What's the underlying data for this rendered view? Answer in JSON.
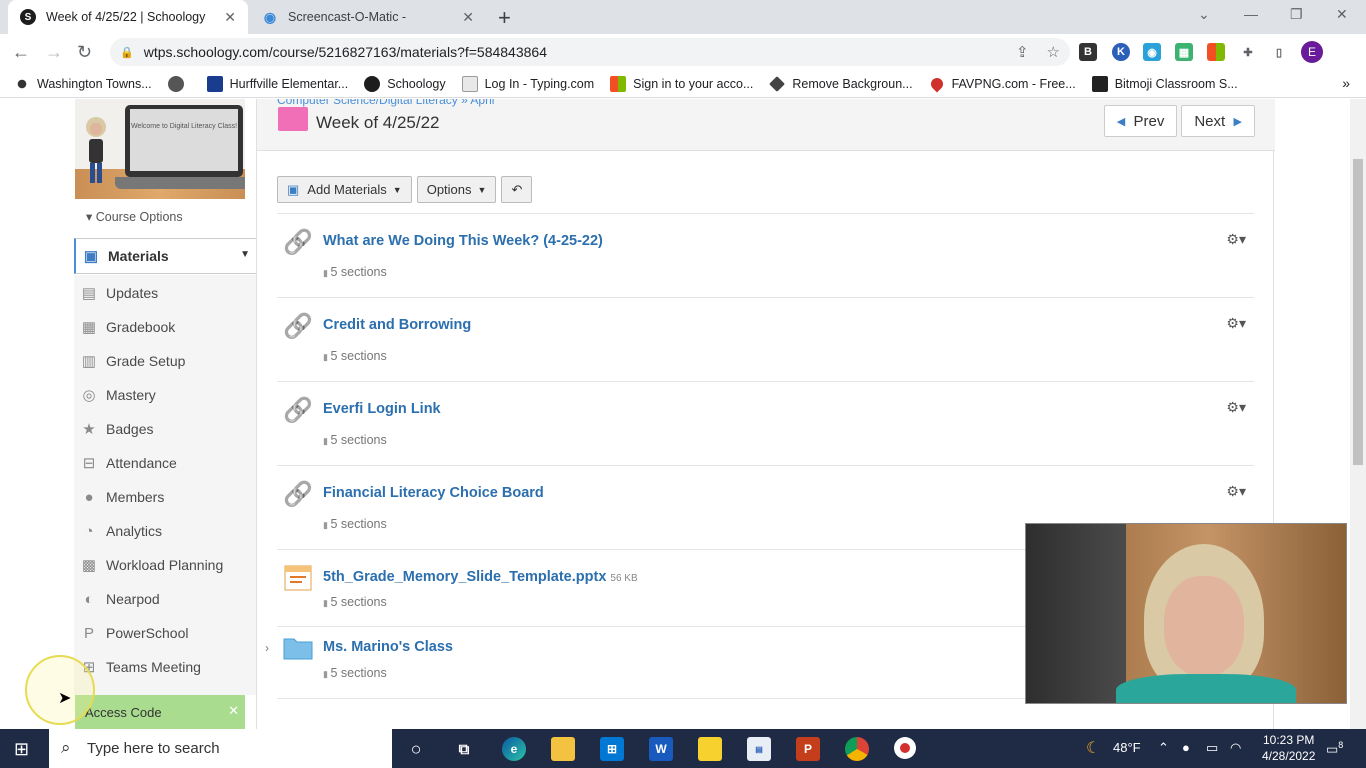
{
  "browser": {
    "tabs": [
      {
        "title": "Week of 4/25/22 | Schoology",
        "favicon": "S",
        "active": true
      },
      {
        "title": "Screencast-O-Matic -",
        "favicon": "◉",
        "active": false
      }
    ],
    "new_tab": "+",
    "url": "wtps.schoology.com/course/5216827163/materials?f=584843864",
    "profile_initial": "E",
    "bookmarks": [
      {
        "label": "Washington Towns..."
      },
      {
        "label": "Hurffville Elementar..."
      },
      {
        "label": "Schoology"
      },
      {
        "label": "Log In - Typing.com"
      },
      {
        "label": "Sign in to your acco..."
      },
      {
        "label": "Remove Backgroun..."
      },
      {
        "label": "FAVPNG.com - Free..."
      },
      {
        "label": "Bitmoji Classroom S..."
      }
    ]
  },
  "sidebar": {
    "course_image_text": "Welcome to Digital Literacy Class!",
    "course_options": "Course Options",
    "items": [
      {
        "label": "Materials",
        "icon": "materials-icon",
        "glyph": "▣"
      },
      {
        "label": "Updates",
        "icon": "updates-icon",
        "glyph": "▤"
      },
      {
        "label": "Gradebook",
        "icon": "gradebook-icon",
        "glyph": "▦"
      },
      {
        "label": "Grade Setup",
        "icon": "grade-setup-icon",
        "glyph": "▥"
      },
      {
        "label": "Mastery",
        "icon": "mastery-icon",
        "glyph": "◎"
      },
      {
        "label": "Badges",
        "icon": "badges-icon",
        "glyph": "★"
      },
      {
        "label": "Attendance",
        "icon": "attendance-icon",
        "glyph": "⊟"
      },
      {
        "label": "Members",
        "icon": "members-icon",
        "glyph": "●"
      },
      {
        "label": "Analytics",
        "icon": "analytics-icon",
        "glyph": "◔"
      },
      {
        "label": "Workload Planning",
        "icon": "workload-icon",
        "glyph": "▩"
      },
      {
        "label": "Nearpod",
        "icon": "nearpod-icon",
        "glyph": "◐"
      },
      {
        "label": "PowerSchool",
        "icon": "powerschool-icon",
        "glyph": "P"
      },
      {
        "label": "Teams Meeting",
        "icon": "teams-icon",
        "glyph": "⊞"
      }
    ],
    "access_code": "Access Code"
  },
  "main": {
    "breadcrumb": "Computer Science/Digital Literacy » April",
    "title": "Week of 4/25/22",
    "prev": "Prev",
    "next": "Next",
    "add_materials": "Add Materials",
    "options": "Options",
    "items": [
      {
        "title": "What are We Doing This Week? (4-25-22)",
        "sub": "5 sections",
        "type": "link",
        "size": ""
      },
      {
        "title": "Credit and Borrowing",
        "sub": "5 sections",
        "type": "link",
        "size": ""
      },
      {
        "title": "Everfi Login Link",
        "sub": "5 sections",
        "type": "link",
        "size": ""
      },
      {
        "title": "Financial Literacy Choice Board",
        "sub": "5 sections",
        "type": "link",
        "size": ""
      },
      {
        "title": "5th_Grade_Memory_Slide_Template.pptx",
        "sub": "5 sections",
        "type": "file",
        "size": "56 KB"
      },
      {
        "title": "Ms. Marino's Class",
        "sub": "5 sections",
        "type": "folder",
        "size": ""
      }
    ]
  },
  "taskbar": {
    "search_placeholder": "Type here to search",
    "weather": "48°F",
    "time": "10:23 PM",
    "date": "4/28/2022",
    "notifications": "8"
  },
  "colors": {
    "link": "#2c6fae",
    "accent": "#3c7dc4",
    "access_code_bg": "#a9dc8f",
    "folder_pink": "#f06fb7"
  }
}
